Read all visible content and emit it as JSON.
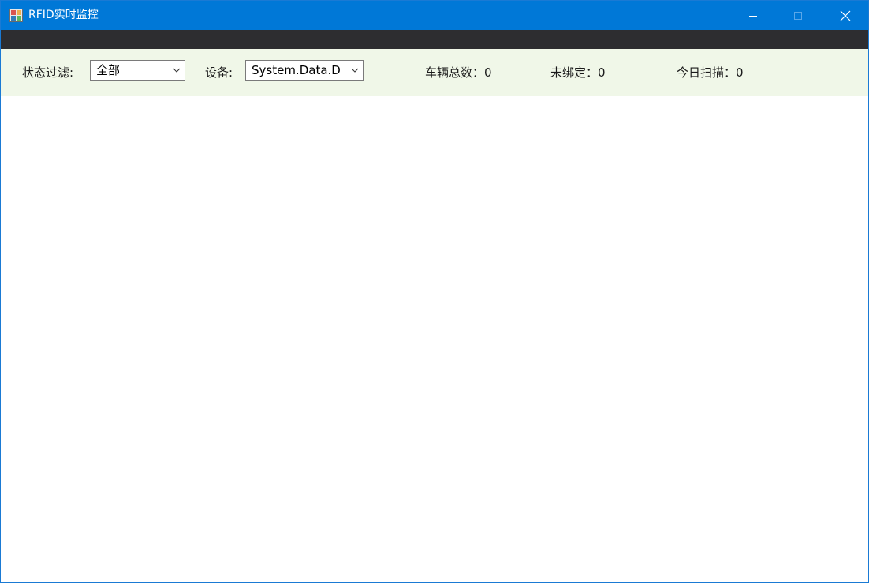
{
  "window": {
    "title": "RFID实时监控",
    "controls": [
      "minimize",
      "maximize",
      "close"
    ]
  },
  "filters": {
    "status_label": "状态过滤:",
    "status_value": "全部",
    "device_label": "设备:",
    "device_value": "System.Data.D"
  },
  "stats": {
    "total_vehicles": "车辆总数：0",
    "unbound": "未绑定：0",
    "today_scans": "今日扫描：0"
  },
  "colors": {
    "titlebar": "#0078d7",
    "menustrip": "#2d2d30",
    "filterbar": "#f0f7e8"
  }
}
